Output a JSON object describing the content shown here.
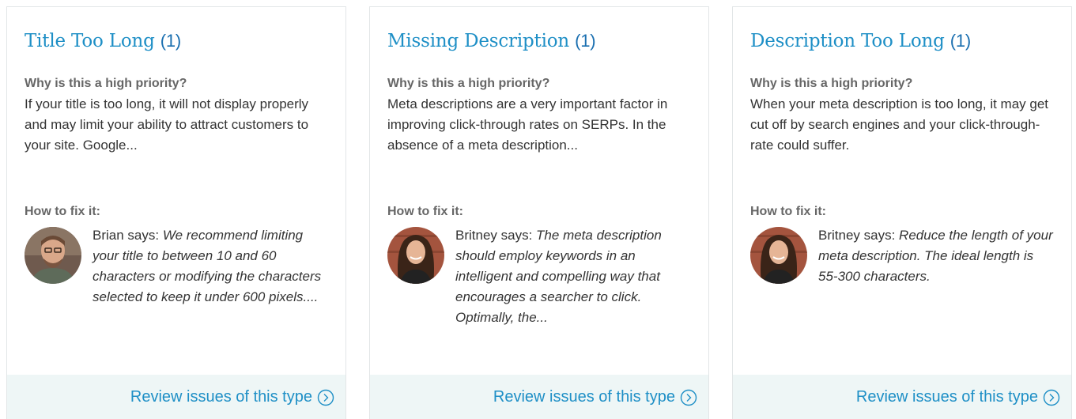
{
  "cards": [
    {
      "title": "Title Too Long",
      "count": "(1)",
      "why_label": "Why is this a high priority?",
      "why_text": "If your title is too long, it will not display properly and may limit your ability to attract customers to your site. Google...",
      "fix_label": "How to fix it:",
      "advisor": "Brian says:",
      "advice": "We recommend limiting your title to between 10 and 60 characters or modifying the characters selected to keep it under 600 pixels....",
      "link": "Review issues of this type"
    },
    {
      "title": "Missing Description",
      "count": "(1)",
      "why_label": "Why is this a high priority?",
      "why_text": "Meta descriptions are a very important factor in improving click-through rates on SERPs. In the absence of a meta description...",
      "fix_label": "How to fix it:",
      "advisor": "Britney says:",
      "advice": "The meta description should employ keywords in an intelligent and compelling way that encourages a searcher to click. Optimally, the...",
      "link": "Review issues of this type"
    },
    {
      "title": "Description Too Long",
      "count": "(1)",
      "why_label": "Why is this a high priority?",
      "why_text": "When your meta description is too long, it may get cut off by search engines and your click-through-rate could suffer.",
      "fix_label": "How to fix it:",
      "advisor": "Britney says:",
      "advice": "Reduce the length of your meta description. The ideal length is 55-300 characters.",
      "link": "Review issues of this type"
    }
  ],
  "colors": {
    "title": "#1e8fc6",
    "footer_bg": "#eef6f6",
    "border": "#e2e6e7"
  },
  "icons": {
    "link_icon": "chevron-right-circle-icon",
    "avatar": "person-avatar"
  }
}
